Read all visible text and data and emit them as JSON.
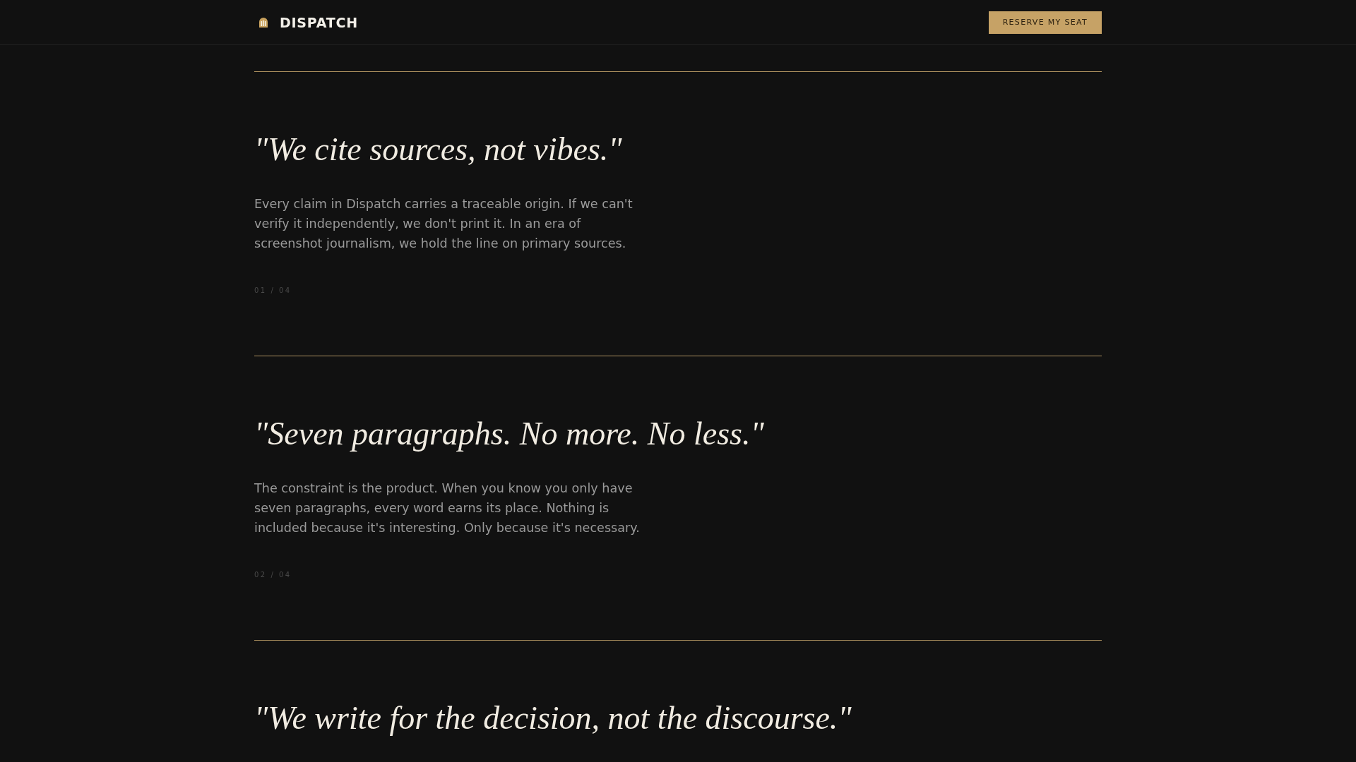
{
  "header": {
    "logo_text": "DISPATCH",
    "cta_button": "RESERVE MY SEAT"
  },
  "principles": [
    {
      "quote": "\"We cite sources, not vibes.\"",
      "body": "Every claim in Dispatch carries a traceable origin. If we can't verify it independently, we don't print it. In an era of screenshot journalism, we hold the line on primary sources.",
      "counter": "01 / 04"
    },
    {
      "quote": "\"Seven paragraphs. No more. No less.\"",
      "body": "The constraint is the product. When you know you only have seven paragraphs, every word earns its place. Nothing is included because it's interesting. Only because it's necessary.",
      "counter": "02 / 04"
    },
    {
      "quote": "\"We write for the decision, not the discourse.\""
    }
  ]
}
